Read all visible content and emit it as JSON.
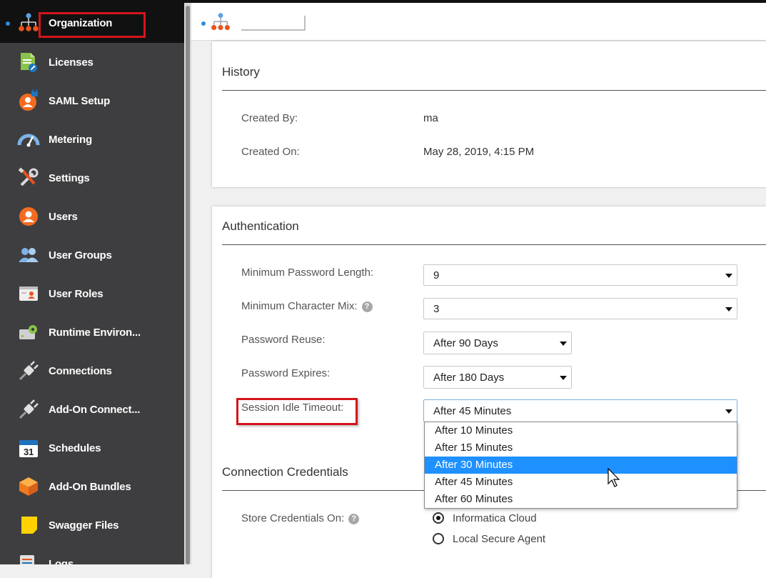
{
  "sidebar": {
    "items": [
      {
        "label": "Organization",
        "icon": "org-chart-icon"
      },
      {
        "label": "Licenses",
        "icon": "license-icon"
      },
      {
        "label": "SAML Setup",
        "icon": "saml-lock-icon"
      },
      {
        "label": "Metering",
        "icon": "gauge-icon"
      },
      {
        "label": "Settings",
        "icon": "wrench-screwdriver-icon"
      },
      {
        "label": "Users",
        "icon": "user-icon"
      },
      {
        "label": "User Groups",
        "icon": "user-group-icon"
      },
      {
        "label": "User Roles",
        "icon": "user-role-icon"
      },
      {
        "label": "Runtime Environ...",
        "icon": "runtime-gear-icon"
      },
      {
        "label": "Connections",
        "icon": "plug-icon"
      },
      {
        "label": "Add-On Connect...",
        "icon": "addon-plug-icon"
      },
      {
        "label": "Schedules",
        "icon": "calendar-icon",
        "badge": "31"
      },
      {
        "label": "Add-On Bundles",
        "icon": "bundle-box-icon"
      },
      {
        "label": "Swagger Files",
        "icon": "swagger-file-icon"
      },
      {
        "label": "Logs",
        "icon": "logs-icon"
      }
    ]
  },
  "history": {
    "title": "History",
    "created_by_label": "Created By:",
    "created_by_value": "ma",
    "created_on_label": "Created On:",
    "created_on_value": "May 28, 2019, 4:15 PM"
  },
  "auth": {
    "title": "Authentication",
    "min_pwd_length_label": "Minimum Password Length:",
    "min_pwd_length_value": "9",
    "min_char_mix_label": "Minimum Character Mix:",
    "min_char_mix_value": "3",
    "pwd_reuse_label": "Password Reuse:",
    "pwd_reuse_value": "After 90 Days",
    "pwd_expires_label": "Password Expires:",
    "pwd_expires_value": "After 180 Days",
    "session_timeout_label": "Session Idle Timeout:",
    "session_timeout_value": "After 45 Minutes",
    "help_glyph": "?"
  },
  "session_timeout_options": [
    "After 10 Minutes",
    "After 15 Minutes",
    "After 30 Minutes",
    "After 45 Minutes",
    "After 60 Minutes"
  ],
  "session_timeout_highlighted_index": 2,
  "credentials": {
    "title": "Connection Credentials",
    "store_label": "Store Credentials On:",
    "options": [
      "Informatica Cloud",
      "Local Secure Agent"
    ],
    "selected_index": 0
  },
  "colors": {
    "sidebar_bg": "#3e3e40",
    "active_bg": "#111111",
    "highlight_red": "#d4151b",
    "accent_blue": "#1e90ff",
    "org_orange": "#e8541c"
  }
}
